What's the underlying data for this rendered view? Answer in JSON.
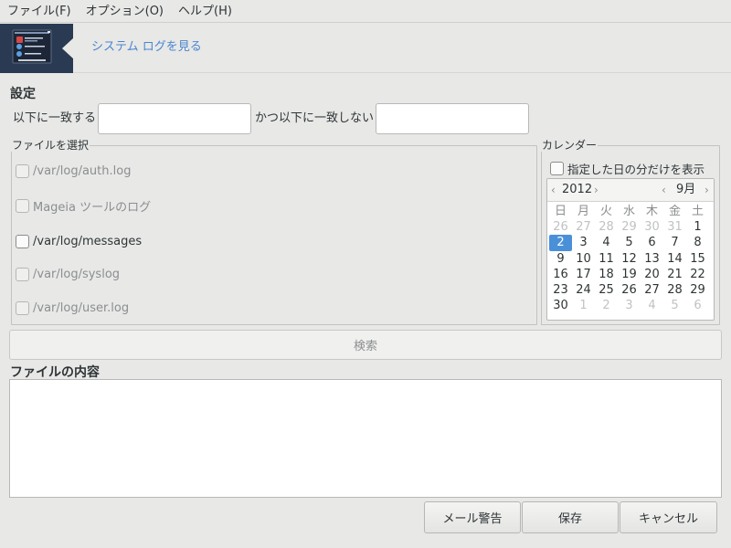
{
  "menu": [
    "ファイル(F)",
    "オプション(O)",
    "ヘルプ(H)"
  ],
  "banner": {
    "title": "システム ログを見る",
    "icon": "log-viewer-icon"
  },
  "settings": {
    "title": "設定",
    "match_label": "以下に一致する",
    "match_value": "",
    "nomatch_label": "かつ以下に一致しない",
    "nomatch_value": ""
  },
  "file_select": {
    "title": "ファイルを選択",
    "items": [
      {
        "label": "/var/log/auth.log",
        "enabled": false,
        "checked": false
      },
      {
        "label": "Mageia ツールのログ",
        "enabled": false,
        "checked": false
      },
      {
        "label": "/var/log/messages",
        "enabled": true,
        "checked": false
      },
      {
        "label": "/var/log/syslog",
        "enabled": false,
        "checked": false
      },
      {
        "label": "/var/log/user.log",
        "enabled": false,
        "checked": false
      }
    ]
  },
  "calendar": {
    "title": "カレンダー",
    "day_only_label": "指定した日の分だけを表示",
    "day_only_checked": false,
    "year": "2012",
    "month": "9月",
    "weekdays": [
      "日",
      "月",
      "火",
      "水",
      "木",
      "金",
      "土"
    ],
    "weeks": [
      [
        [
          "26",
          "other"
        ],
        [
          "27",
          "other"
        ],
        [
          "28",
          "other"
        ],
        [
          "29",
          "other"
        ],
        [
          "30",
          "other"
        ],
        [
          "31",
          "other"
        ],
        [
          "1",
          "cur"
        ]
      ],
      [
        [
          "2",
          "selected"
        ],
        [
          "3",
          "cur"
        ],
        [
          "4",
          "cur"
        ],
        [
          "5",
          "cur"
        ],
        [
          "6",
          "cur"
        ],
        [
          "7",
          "cur"
        ],
        [
          "8",
          "cur"
        ]
      ],
      [
        [
          "9",
          "cur"
        ],
        [
          "10",
          "cur"
        ],
        [
          "11",
          "cur"
        ],
        [
          "12",
          "cur"
        ],
        [
          "13",
          "cur"
        ],
        [
          "14",
          "cur"
        ],
        [
          "15",
          "cur"
        ]
      ],
      [
        [
          "16",
          "cur"
        ],
        [
          "17",
          "cur"
        ],
        [
          "18",
          "cur"
        ],
        [
          "19",
          "cur"
        ],
        [
          "20",
          "cur"
        ],
        [
          "21",
          "cur"
        ],
        [
          "22",
          "cur"
        ]
      ],
      [
        [
          "23",
          "cur"
        ],
        [
          "24",
          "cur"
        ],
        [
          "25",
          "cur"
        ],
        [
          "26",
          "cur"
        ],
        [
          "27",
          "cur"
        ],
        [
          "28",
          "cur"
        ],
        [
          "29",
          "cur"
        ]
      ],
      [
        [
          "30",
          "cur"
        ],
        [
          "1",
          "other"
        ],
        [
          "2",
          "other"
        ],
        [
          "3",
          "other"
        ],
        [
          "4",
          "other"
        ],
        [
          "5",
          "other"
        ],
        [
          "6",
          "other"
        ]
      ]
    ],
    "selected_color": "#4a90d9"
  },
  "search_button": "検索",
  "content": {
    "title": "ファイルの内容",
    "text": ""
  },
  "buttons": {
    "mail_alert": "メール警告",
    "save": "保存",
    "cancel": "キャンセル"
  },
  "colors": {
    "accent": "#4a86cf",
    "banner_bg": "#2a3a52"
  }
}
